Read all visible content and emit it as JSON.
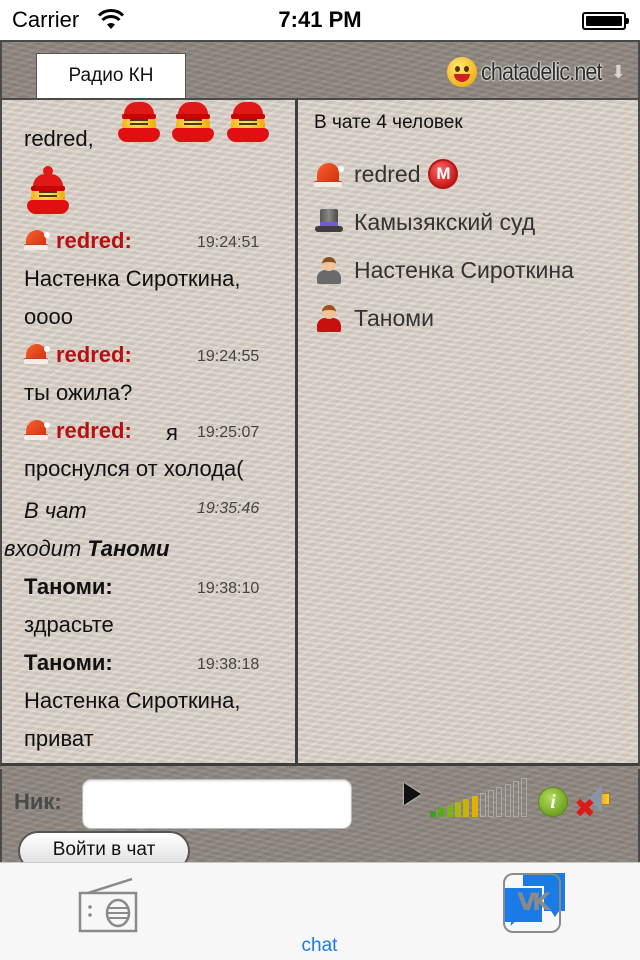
{
  "status_bar": {
    "carrier": "Carrier",
    "time": "7:41 PM",
    "wifi_icon": "wifi-icon",
    "battery_icon": "battery-full-icon"
  },
  "header": {
    "tab_label": "Радио КН",
    "brand_name": "chatadelic.net",
    "brand_icon": "smiley-icon",
    "arrow_icon": "arrow-down-icon"
  },
  "chat": {
    "messages": [
      {
        "type": "text",
        "text": "redred,"
      },
      {
        "type": "user",
        "nick": "redred:",
        "nick_color": "#b81010",
        "time": "19:24:51",
        "text_line1": "Настенка Сироткина,",
        "text_line2": "оооо"
      },
      {
        "type": "user",
        "nick": "redred:",
        "nick_color": "#b81010",
        "time": "19:24:55",
        "text_line1": "ты ожила?"
      },
      {
        "type": "user",
        "nick": "redred:",
        "nick_color": "#b81010",
        "time": "19:25:07",
        "inline": "я",
        "text_line1": "проснулся от холода("
      },
      {
        "type": "system",
        "prefix": "В чат",
        "time": "19:35:46",
        "line2": "входит",
        "name": "Таноми"
      },
      {
        "type": "user",
        "nick": "Таноми:",
        "time": "19:38:10",
        "text_line1": "здрасьте"
      },
      {
        "type": "user",
        "nick": "Таноми:",
        "time": "19:38:18",
        "text_line1": "Настенка Сироткина,",
        "text_line2": "приват"
      }
    ]
  },
  "users": {
    "title": "В чате 4 человек",
    "list": [
      {
        "name": "redred",
        "avatar": "santa-hat-icon",
        "badge": "М"
      },
      {
        "name": "Камызякский суд",
        "avatar": "top-hat-icon"
      },
      {
        "name": "Настенка Сироткина",
        "avatar": "gray-person-icon"
      },
      {
        "name": "Таноми",
        "avatar": "red-person-icon"
      }
    ]
  },
  "input_bar": {
    "nick_label": "Ник:",
    "nick_value": "",
    "nick_placeholder": "",
    "join_button": "Войти в чат",
    "volume_level_percent": 50,
    "volume_bars_total": 12,
    "volume_bars_lit": 6,
    "info_glyph": "i",
    "mute_glyph": "✖"
  },
  "colors": {
    "accent_blue": "#1a7ae6",
    "nick_red": "#b81010"
  },
  "tabbar": {
    "tabs": [
      {
        "label": "",
        "icon": "radio-icon",
        "active": false
      },
      {
        "label": "chat",
        "icon": "chat-bubbles-icon",
        "active": true
      },
      {
        "label": "",
        "icon": "vk-icon",
        "active": false
      }
    ],
    "vk_text": "VK"
  }
}
